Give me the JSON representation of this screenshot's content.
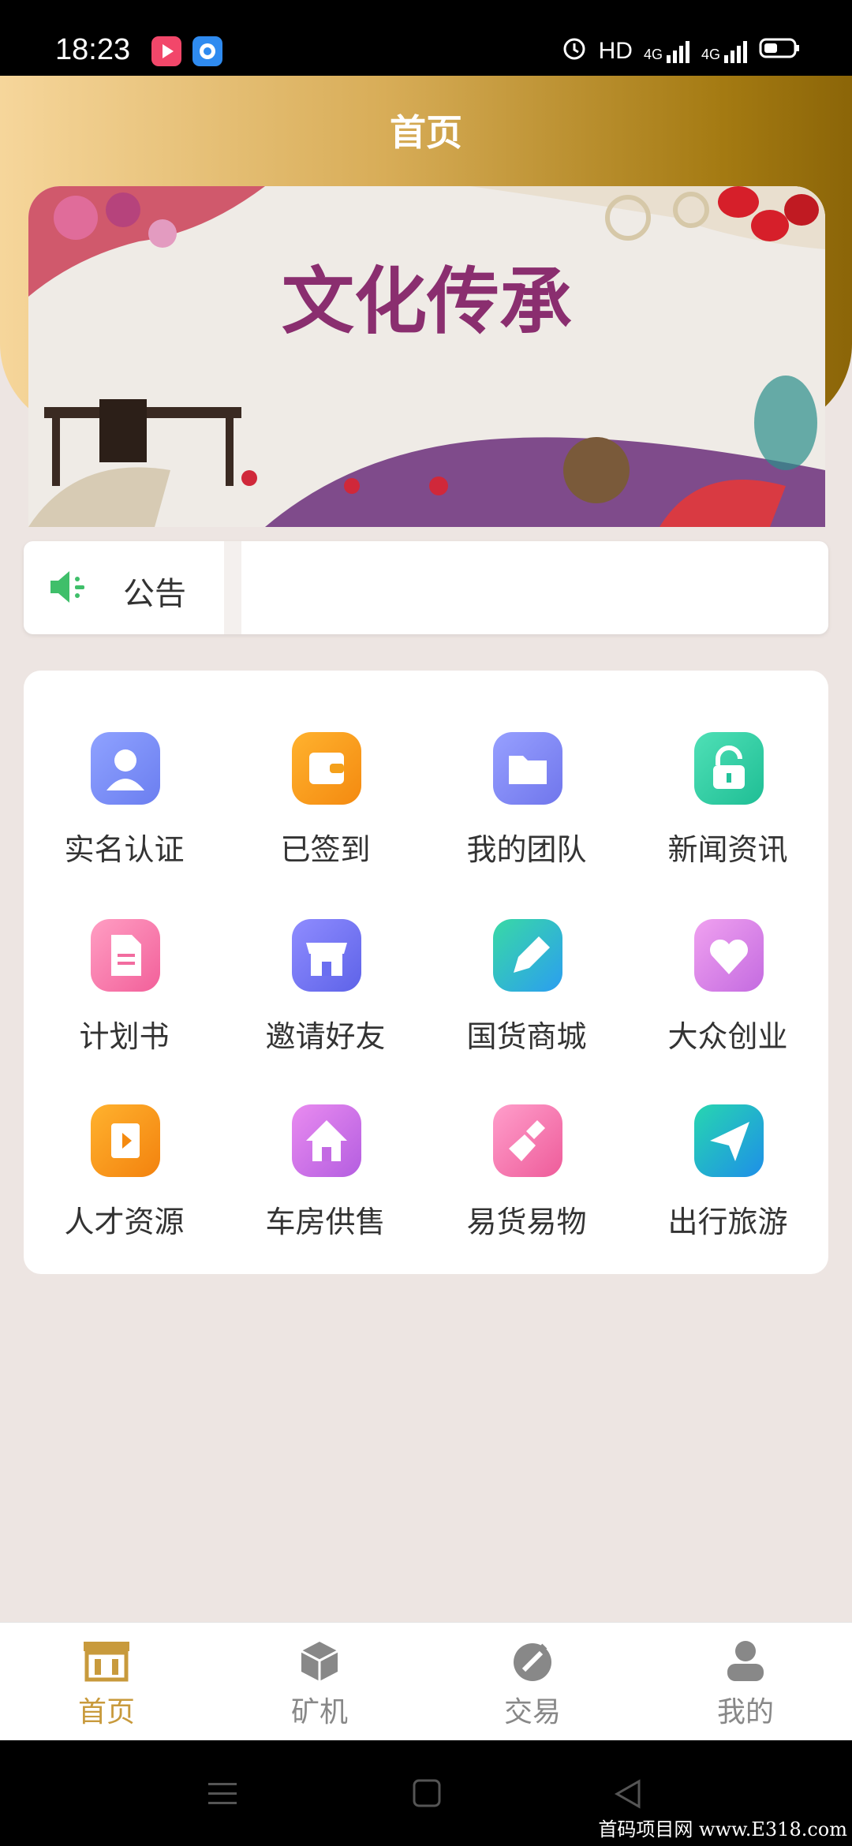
{
  "status_bar": {
    "time": "18:23",
    "hd": "HD",
    "network1": "4G",
    "network2": "4G"
  },
  "header": {
    "title": "首页"
  },
  "banner": {
    "text": "文化传承"
  },
  "notice": {
    "label": "公告",
    "icon": "speaker-icon"
  },
  "grid": [
    {
      "label": "实名认证",
      "icon": "user-icon"
    },
    {
      "label": "已签到",
      "icon": "wallet-icon"
    },
    {
      "label": "我的团队",
      "icon": "folder-icon"
    },
    {
      "label": "新闻资讯",
      "icon": "lock-icon"
    },
    {
      "label": "计划书",
      "icon": "document-icon"
    },
    {
      "label": "邀请好友",
      "icon": "store-icon"
    },
    {
      "label": "国货商城",
      "icon": "edit-icon"
    },
    {
      "label": "大众创业",
      "icon": "heart-icon"
    },
    {
      "label": "人才资源",
      "icon": "play-icon"
    },
    {
      "label": "车房供售",
      "icon": "home-icon"
    },
    {
      "label": "易货易物",
      "icon": "broom-icon"
    },
    {
      "label": "出行旅游",
      "icon": "send-icon"
    }
  ],
  "bottom_nav": [
    {
      "label": "首页",
      "icon": "shop-icon",
      "active": true
    },
    {
      "label": "矿机",
      "icon": "cube-icon",
      "active": false
    },
    {
      "label": "交易",
      "icon": "trade-icon",
      "active": false
    },
    {
      "label": "我的",
      "icon": "person-icon",
      "active": false
    }
  ],
  "watermark": "首码项目网 www.E318.com",
  "colors": {
    "accent": "#c89a3c",
    "inactive": "#888888",
    "header_start": "#f6d69b",
    "header_end": "#8b6508"
  }
}
